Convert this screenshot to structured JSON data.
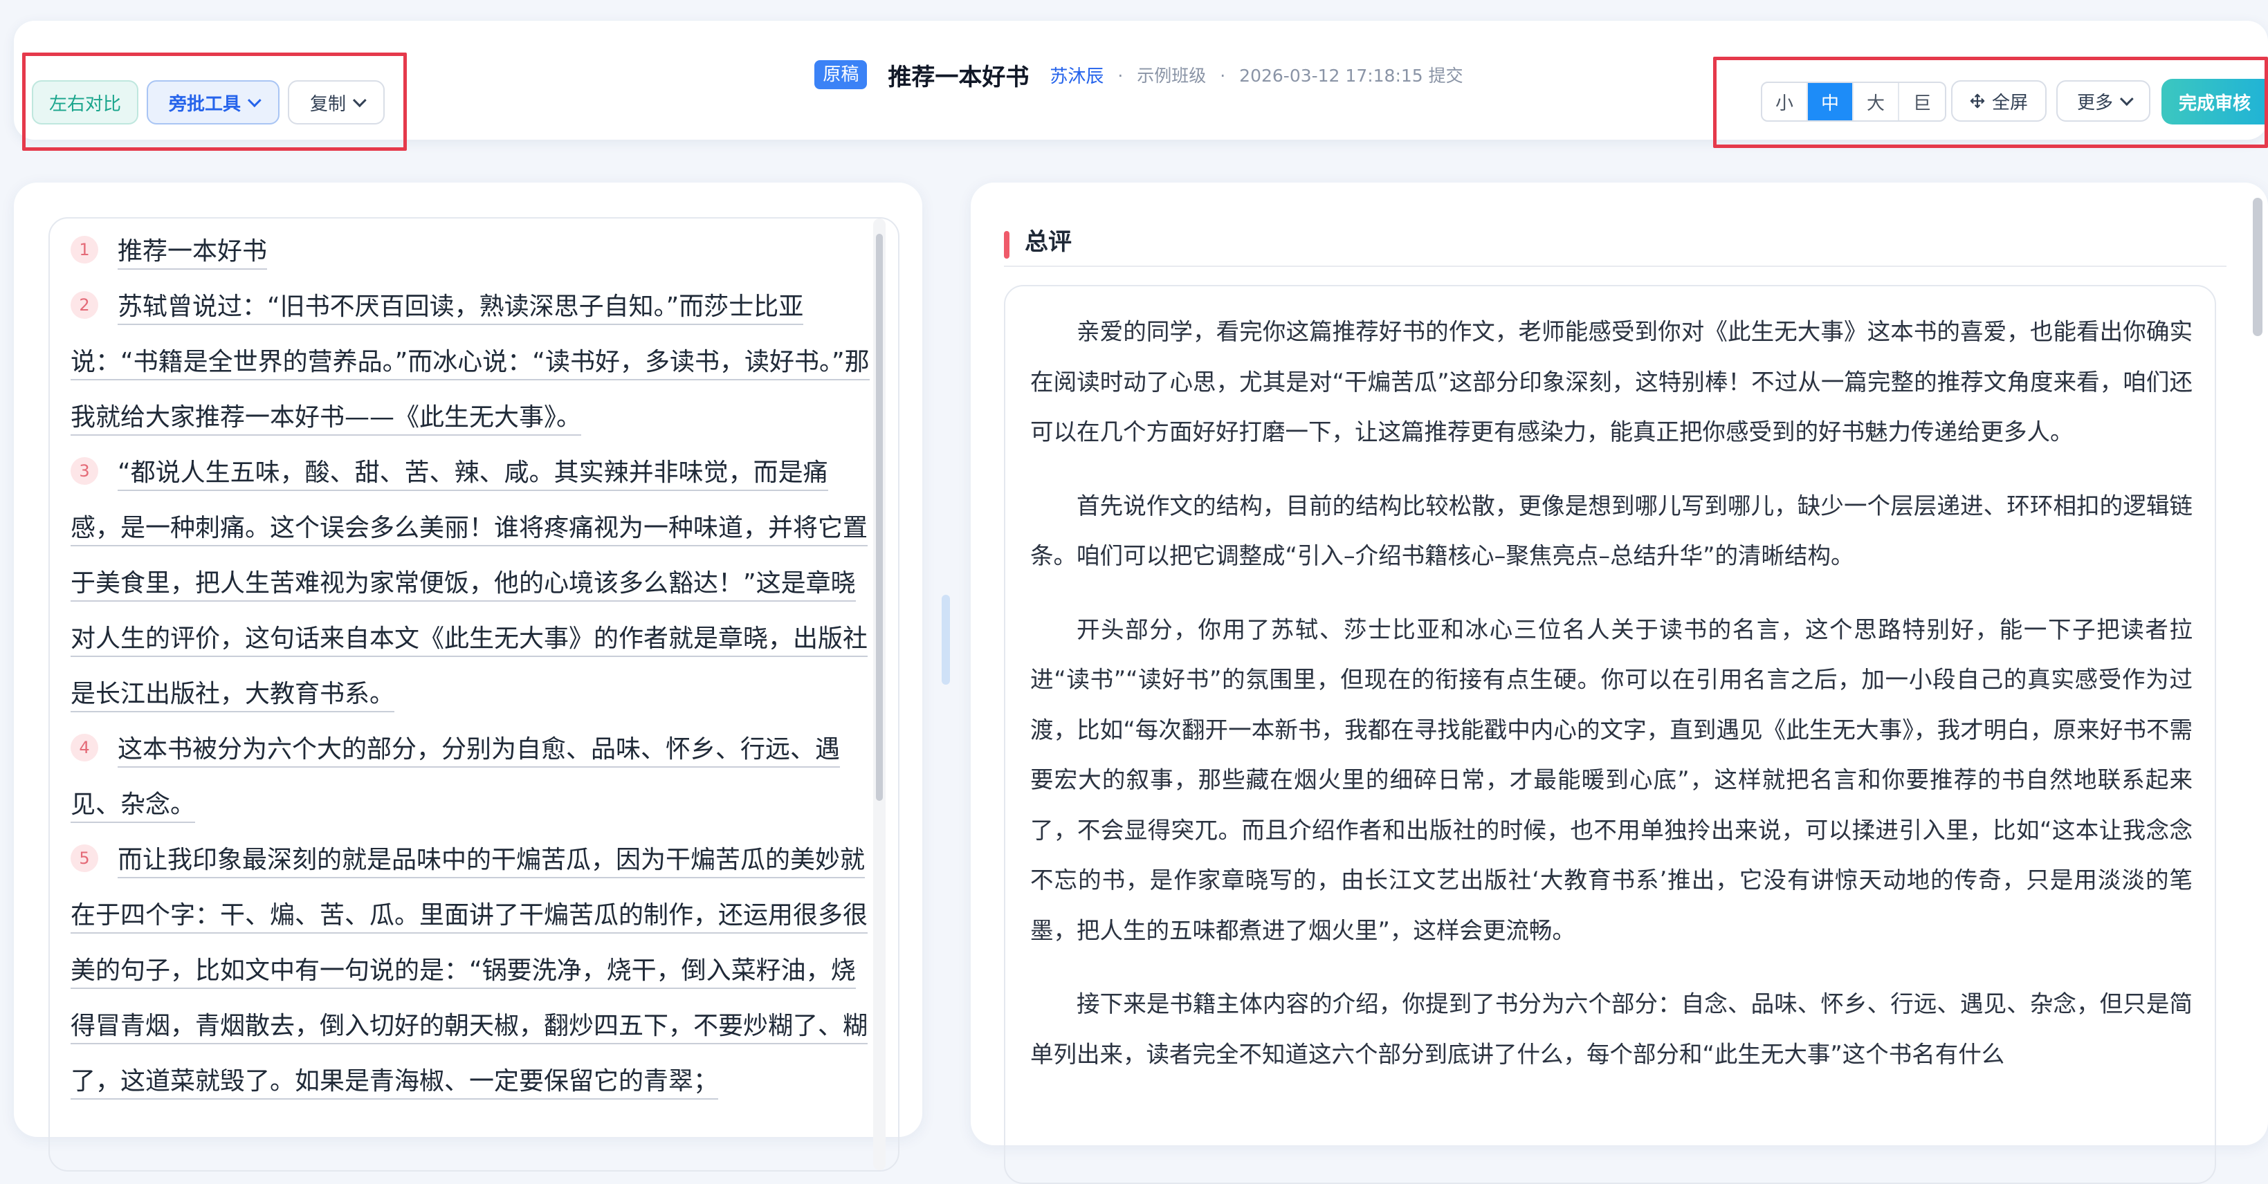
{
  "header": {
    "tag": "原稿",
    "title": "推荐一本好书",
    "author": "苏沐辰",
    "sep": "·",
    "class_name": "示例班级",
    "submitted": "2026-03-12 17:18:15 提交"
  },
  "toolbar_left": {
    "compare": "左右对比",
    "annotate": "旁批工具",
    "copy": "复制"
  },
  "toolbar_right": {
    "sizes": [
      "小",
      "中",
      "大",
      "巨"
    ],
    "active_size": "中",
    "fullscreen": "全屏",
    "more": "更多",
    "finish": "完成审核"
  },
  "essay": {
    "paragraphs": [
      {
        "num": "1",
        "text": "推荐一本好书"
      },
      {
        "num": "2",
        "text": "苏轼曾说过：“旧书不厌百回读，熟读深思子自知。”而莎士比亚说：“书籍是全世界的营养品。”而冰心说：“读书好，多读书，读好书。”那我就给大家推荐一本好书——《此生无大事》。"
      },
      {
        "num": "3",
        "text": "“都说人生五味，酸、甜、苦、辣、咸。其实辣并非味觉，而是痛感，是一种刺痛。这个误会多么美丽！谁将疼痛视为一种味道，并将它置于美食里，把人生苦难视为家常便饭，他的心境该多么豁达！”这是章晓对人生的评价，这句话来自本文《此生无大事》的作者就是章晓，出版社是长江出版社，大教育书系。"
      },
      {
        "num": "4",
        "text": "这本书被分为六个大的部分，分别为自愈、品味、怀乡、行远、遇见、杂念。"
      },
      {
        "num": "5",
        "text": "而让我印象最深刻的就是品味中的干煸苦瓜，因为干煸苦瓜的美妙就在于四个字：干、煸、苦、瓜。里面讲了干煸苦瓜的制作，还运用很多很美的句子，比如文中有一句说的是：“锅要洗净，烧干，倒入菜籽油，烧得冒青烟，青烟散去，倒入切好的朝天椒，翻炒四五下，不要炒糊了、糊了，这道菜就毁了。如果是青海椒、一定要保留它的青翠；"
      }
    ]
  },
  "review": {
    "title": "总评",
    "paragraphs": [
      "亲爱的同学，看完你这篇推荐好书的作文，老师能感受到你对《此生无大事》这本书的喜爱，也能看出你确实在阅读时动了心思，尤其是对“干煸苦瓜”这部分印象深刻，这特别棒！不过从一篇完整的推荐文角度来看，咱们还可以在几个方面好好打磨一下，让这篇推荐更有感染力，能真正把你感受到的好书魅力传递给更多人。",
      "首先说作文的结构，目前的结构比较松散，更像是想到哪儿写到哪儿，缺少一个层层递进、环环相扣的逻辑链条。咱们可以把它调整成“引入–介绍书籍核心–聚焦亮点–总结升华”的清晰结构。",
      "开头部分，你用了苏轼、莎士比亚和冰心三位名人关于读书的名言，这个思路特别好，能一下子把读者拉进“读书”“读好书”的氛围里，但现在的衔接有点生硬。你可以在引用名言之后，加一小段自己的真实感受作为过渡，比如“每次翻开一本新书，我都在寻找能戳中内心的文字，直到遇见《此生无大事》，我才明白，原来好书不需要宏大的叙事，那些藏在烟火里的细碎日常，才最能暖到心底”，这样就把名言和你要推荐的书自然地联系起来了，不会显得突兀。而且介绍作者和出版社的时候，也不用单独拎出来说，可以揉进引入里，比如“这本让我念念不忘的书，是作家章晓写的，由长江文艺出版社‘大教育书系’推出，它没有讲惊天动地的传奇，只是用淡淡的笔墨，把人生的五味都煮进了烟火里”，这样会更流畅。",
      "接下来是书籍主体内容的介绍，你提到了书分为六个部分：自念、品味、怀乡、行远、遇见、杂念，但只是简单列出来，读者完全不知道这六个部分到底讲了什么，每个部分和“此生无大事”这个书名有什么"
    ]
  }
}
